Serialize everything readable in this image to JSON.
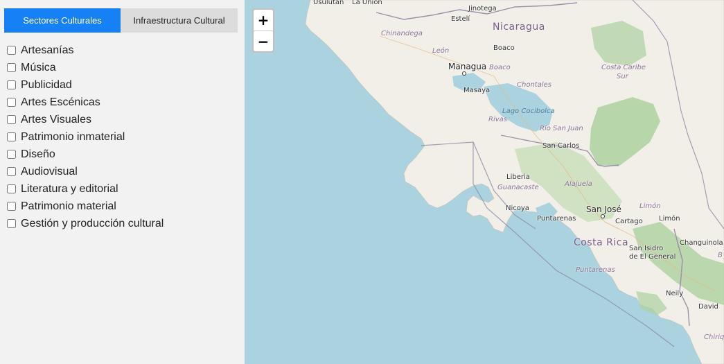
{
  "sidebar": {
    "tabs": [
      {
        "label": "Sectores Culturales",
        "active": true
      },
      {
        "label": "Infraestructura Cultural",
        "active": false
      }
    ],
    "categories": [
      {
        "label": "Artesanías",
        "checked": false
      },
      {
        "label": "Música",
        "checked": false
      },
      {
        "label": "Publicidad",
        "checked": false
      },
      {
        "label": "Artes Escénicas",
        "checked": false
      },
      {
        "label": "Artes Visuales",
        "checked": false
      },
      {
        "label": "Patrimonio inmaterial",
        "checked": false
      },
      {
        "label": "Diseño",
        "checked": false
      },
      {
        "label": "Audiovisual",
        "checked": false
      },
      {
        "label": "Literatura y editorial",
        "checked": false
      },
      {
        "label": "Patrimonio material",
        "checked": false
      },
      {
        "label": "Gestión y producción cultural",
        "checked": false
      }
    ]
  },
  "map": {
    "zoom": {
      "in_label": "+",
      "out_label": "−"
    },
    "colors": {
      "water": "#aad3df",
      "land": "#f2efe9",
      "forest": "#add19e",
      "border": "#9e8fa8",
      "lake": "#aad3df"
    },
    "labels": {
      "usulutan": "Usulután",
      "la_union": "La Unión",
      "jinotega": "Jinotega",
      "esteli": "Estelí",
      "nicaragua": "Nicaragua",
      "chinandega": "Chinandega",
      "boaco_city": "Boaco",
      "leon": "León",
      "managua": "Managua",
      "boaco_region": "Boaco",
      "costa_caribe_sur_1": "Costa Caribe",
      "costa_caribe_sur_2": "Sur",
      "masaya": "Masaya",
      "chontales": "Chontales",
      "lago_cocibolca": "Lago Cocibolca",
      "rivas": "Rivas",
      "rio_san_juan": "Río San Juan",
      "san_carlos": "San Carlos",
      "liberia": "Liberia",
      "guanacaste": "Guanacaste",
      "alajuela": "Alajuela",
      "nicoya": "Nicoya",
      "san_jose": "San José",
      "limon_region": "Limón",
      "puntarenas_city": "Puntarenas",
      "cartago": "Cartago",
      "limon_city": "Limón",
      "costa_rica": "Costa Rica",
      "changuinola": "Changuinola",
      "san_isidro_1": "San Isidro",
      "san_isidro_2": "de El General",
      "puntarenas_region": "Puntarenas",
      "neily": "Neily",
      "david": "David",
      "chiriqui": "Chiriq",
      "bocas_partial": "B"
    }
  }
}
